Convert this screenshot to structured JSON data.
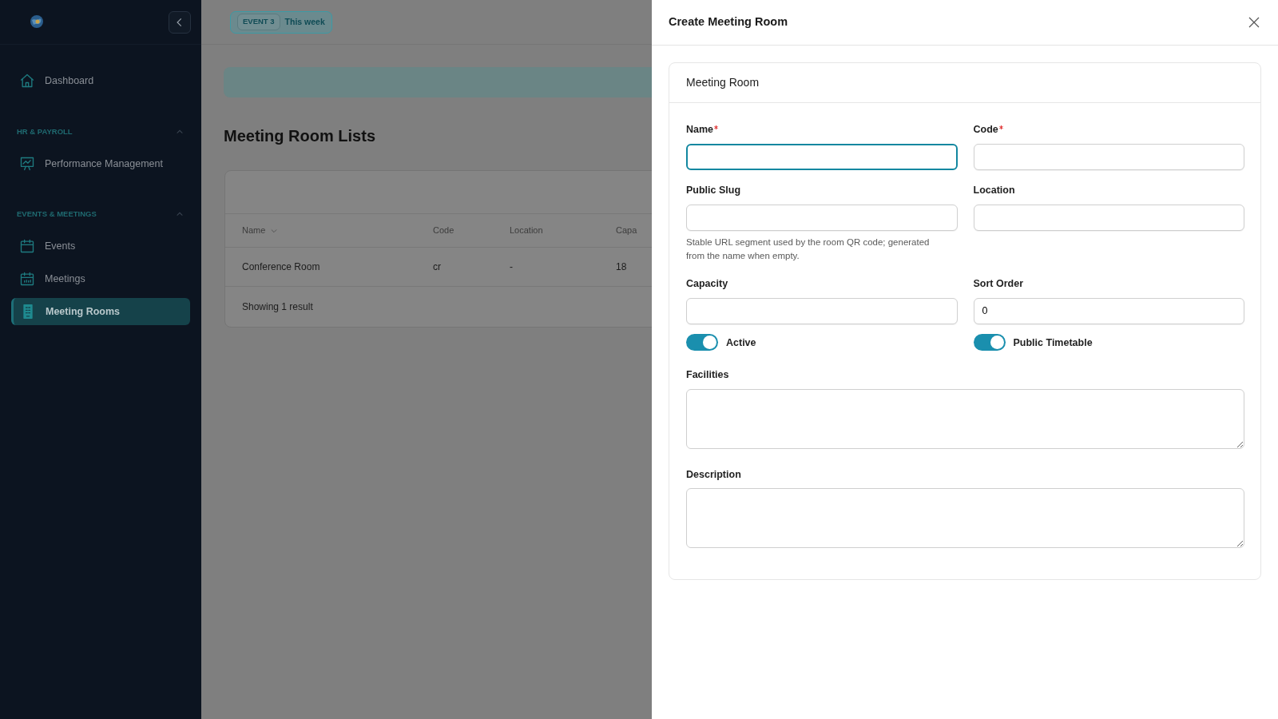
{
  "sidebar": {
    "top_items": [
      {
        "label": "Dashboard",
        "selected": false
      }
    ],
    "sections": [
      {
        "title": "HR & PAYROLL",
        "expanded": true,
        "items": [
          {
            "label": "Performance Management",
            "selected": false
          }
        ]
      },
      {
        "title": "EVENTS & MEETINGS",
        "expanded": true,
        "items": [
          {
            "label": "Events",
            "selected": false
          },
          {
            "label": "Meetings",
            "selected": false
          },
          {
            "label": "Meeting Rooms",
            "selected": true
          }
        ]
      }
    ]
  },
  "topbar": {
    "event_badge": "EVENT 3",
    "period": "This week"
  },
  "page": {
    "title": "Meeting Room Lists",
    "table": {
      "columns": [
        {
          "label": "Name",
          "sortable": true
        },
        {
          "label": "Code",
          "sortable": false
        },
        {
          "label": "Location",
          "sortable": false
        },
        {
          "label": "Capa",
          "sortable": false
        }
      ],
      "rows": [
        [
          "Conference Room",
          "cr",
          "-",
          "18"
        ]
      ],
      "footer": "Showing 1 result"
    }
  },
  "drawer": {
    "title": "Create Meeting Room",
    "card_title": "Meeting Room",
    "fields": [
      {
        "kind": "input",
        "label": "Name",
        "required": true,
        "focused": true
      },
      {
        "kind": "input",
        "label": "Code",
        "required": true,
        "focused": false
      },
      {
        "kind": "input",
        "label": "Public Slug",
        "required": false,
        "focused": false,
        "help": "Stable URL segment used by the room QR code; generated from the name when empty."
      },
      {
        "kind": "input",
        "label": "Location",
        "required": false,
        "focused": false
      },
      {
        "kind": "input",
        "label": "Capacity",
        "required": false,
        "focused": false
      },
      {
        "kind": "input",
        "label": "Sort Order",
        "required": false,
        "focused": false,
        "value": "0"
      },
      {
        "kind": "toggle",
        "label": "Active",
        "on": true
      },
      {
        "kind": "toggle",
        "label": "Public Timetable",
        "on": true
      },
      {
        "kind": "textarea",
        "label": "Facilities",
        "required": false,
        "focused": false
      },
      {
        "kind": "textarea",
        "label": "Description",
        "required": false,
        "focused": false
      }
    ]
  }
}
